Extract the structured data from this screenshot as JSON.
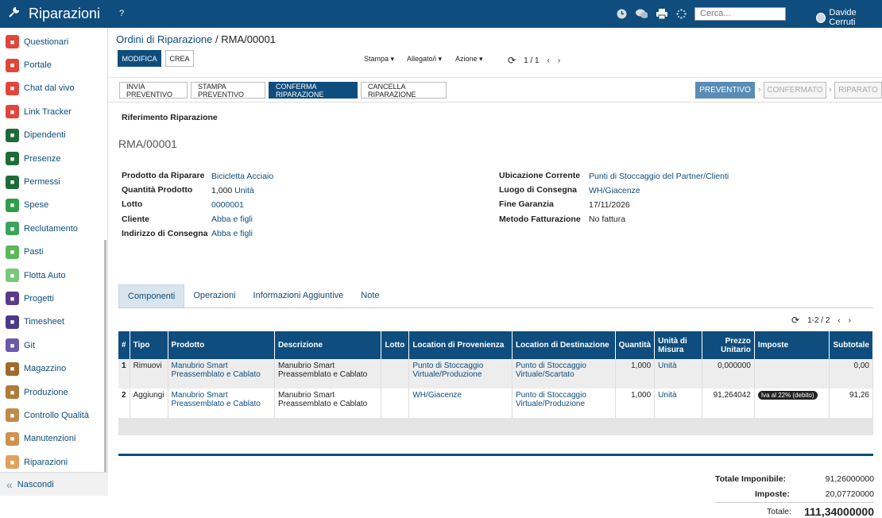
{
  "app": {
    "title": "Riparazioni",
    "help": "?",
    "search_placeholder": "Cerca...",
    "user": "Davide Cerruti"
  },
  "sidebar": {
    "items": [
      {
        "label": "Questionari",
        "icon": "questionnaire-icon",
        "color": "#e0463b"
      },
      {
        "label": "Portale",
        "icon": "portal-icon",
        "color": "#e0463b"
      },
      {
        "label": "Chat dal vivo",
        "icon": "chat-icon",
        "color": "#e0463b"
      },
      {
        "label": "Link Tracker",
        "icon": "link-icon",
        "color": "#e0463b"
      },
      {
        "label": "Dipendenti",
        "icon": "employees-icon",
        "color": "#1e6b3a"
      },
      {
        "label": "Presenze",
        "icon": "attendance-icon",
        "color": "#1e6b3a"
      },
      {
        "label": "Permessi",
        "icon": "leave-icon",
        "color": "#1e6b3a"
      },
      {
        "label": "Spese",
        "icon": "expense-icon",
        "color": "#2e9e4a"
      },
      {
        "label": "Reclutamento",
        "icon": "recruitment-icon",
        "color": "#3aa55a"
      },
      {
        "label": "Pasti",
        "icon": "meals-icon",
        "color": "#5cb85c"
      },
      {
        "label": "Flotta Auto",
        "icon": "fleet-icon",
        "color": "#7ac67a"
      },
      {
        "label": "Progetti",
        "icon": "project-icon",
        "color": "#5a3a8a"
      },
      {
        "label": "Timesheet",
        "icon": "timesheet-icon",
        "color": "#4a3a8a"
      },
      {
        "label": "Git",
        "icon": "git-icon",
        "color": "#6a5aaa"
      },
      {
        "label": "Magazzino",
        "icon": "warehouse-icon",
        "color": "#a06a2a"
      },
      {
        "label": "Produzione",
        "icon": "production-icon",
        "color": "#b07a3a"
      },
      {
        "label": "Controllo Qualità",
        "icon": "quality-icon",
        "color": "#c08a4a"
      },
      {
        "label": "Manutenzioni",
        "icon": "maintenance-icon",
        "color": "#d09050"
      },
      {
        "label": "Riparazioni",
        "icon": "repair-icon",
        "color": "#e0a060"
      }
    ],
    "hide": "Nascondi"
  },
  "breadcrumb": {
    "parent": "Ordini di Riparazione",
    "sep": "/",
    "current": "RMA/00001"
  },
  "toolbar": {
    "edit": "MODIFICA",
    "create": "CREA",
    "print": "Stampa",
    "attach": "Allegato/i",
    "action": "Azione",
    "pager": "1 / 1"
  },
  "actions": [
    "INVIA PREVENTIVO",
    "STAMPA PREVENTIVO",
    "CONFERMA RIPARAZIONE",
    "CANCELLA RIPARAZIONE"
  ],
  "stages": [
    "PREVENTIVO",
    "CONFERMATO",
    "RIPARATO"
  ],
  "form": {
    "section": "Riferimento Riparazione",
    "reference": "RMA/00001",
    "left": [
      {
        "label": "Prodotto da Riparare",
        "value": "Bicicletta Acciaio"
      },
      {
        "label": "Quantità Prodotto",
        "value": "1,000",
        "unit": "Unità"
      },
      {
        "label": "Lotto",
        "value": "0000001"
      },
      {
        "label": "Cliente",
        "value": "Abba e figli"
      },
      {
        "label": "Indirizzo di Consegna",
        "value": "Abba e figli"
      }
    ],
    "right": [
      {
        "label": "Ubicazione Corrente",
        "value": "Punti di Stoccaggio del Partner/Clienti"
      },
      {
        "label": "Luogo di Consegna",
        "value": "WH/Giacenze"
      },
      {
        "label": "Fine Garanzia",
        "value": "17/11/2026"
      },
      {
        "label": "Metodo Fatturazione",
        "value": "No fattura"
      }
    ]
  },
  "tabs": [
    "Componenti",
    "Operazioni",
    "Informazioni Aggiuntive",
    "Note"
  ],
  "list_pager": "1-2 / 2",
  "table": {
    "headers": [
      "#",
      "Tipo",
      "Prodotto",
      "Descrizione",
      "Lotto",
      "Location di Provenienza",
      "Location di Destinazione",
      "Quantità",
      "Unità di Misura",
      "Prezzo Unitario",
      "Imposte",
      "Subtotale"
    ],
    "rows": [
      {
        "n": "1",
        "tipo": "Rimuovi",
        "prodotto": "Manubrio Smart Preassemblato e Cablato",
        "descr": "Manubrio Smart Preassemblato e Cablato",
        "lotto": "",
        "prov": "Punto di Stoccaggio Virtuale/Produzione",
        "dest": "Punto di Stoccaggio Virtuale/Scartato",
        "qty": "1,000",
        "uom": "Unità",
        "price": "0,000000",
        "tax": "",
        "sub": "0,00"
      },
      {
        "n": "2",
        "tipo": "Aggiungi",
        "prodotto": "Manubrio Smart Preassemblato e Cablato",
        "descr": "Manubrio Smart Preassemblato e Cablato",
        "lotto": "",
        "prov": "WH/Giacenze",
        "dest": "Punto di Stoccaggio Virtuale/Produzione",
        "qty": "1,000",
        "uom": "Unità",
        "price": "91,264042",
        "tax": "Iva al 22% (debito)",
        "sub": "91,26"
      }
    ]
  },
  "totals": {
    "imponibile_label": "Totale Imponibile:",
    "imponibile": "91,26000000",
    "imposte_label": "Imposte:",
    "imposte": "20,07720000",
    "totale_label": "Totale:",
    "totale": "111,34000000"
  }
}
